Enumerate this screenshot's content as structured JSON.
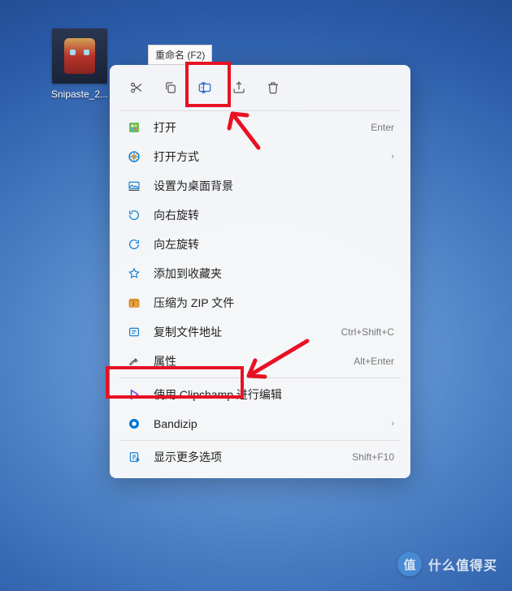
{
  "desktop": {
    "icon_label": "Snipaste_2..."
  },
  "tooltip": "重命名 (F2)",
  "context_menu": {
    "items": [
      {
        "label": "打开",
        "shortcut": "Enter",
        "arrow": false
      },
      {
        "label": "打开方式",
        "shortcut": "",
        "arrow": true
      },
      {
        "label": "设置为桌面背景",
        "shortcut": "",
        "arrow": false
      },
      {
        "label": "向右旋转",
        "shortcut": "",
        "arrow": false
      },
      {
        "label": "向左旋转",
        "shortcut": "",
        "arrow": false
      },
      {
        "label": "添加到收藏夹",
        "shortcut": "",
        "arrow": false
      },
      {
        "label": "压缩为 ZIP 文件",
        "shortcut": "",
        "arrow": false
      },
      {
        "label": "复制文件地址",
        "shortcut": "Ctrl+Shift+C",
        "arrow": false
      },
      {
        "label": "属性",
        "shortcut": "Alt+Enter",
        "arrow": false
      },
      {
        "label": "使用 Clipchamp 进行编辑",
        "shortcut": "",
        "arrow": false
      },
      {
        "label": "Bandizip",
        "shortcut": "",
        "arrow": true
      },
      {
        "label": "显示更多选项",
        "shortcut": "Shift+F10",
        "arrow": false
      }
    ]
  },
  "watermark": {
    "badge": "值",
    "text": "什么值得买"
  }
}
